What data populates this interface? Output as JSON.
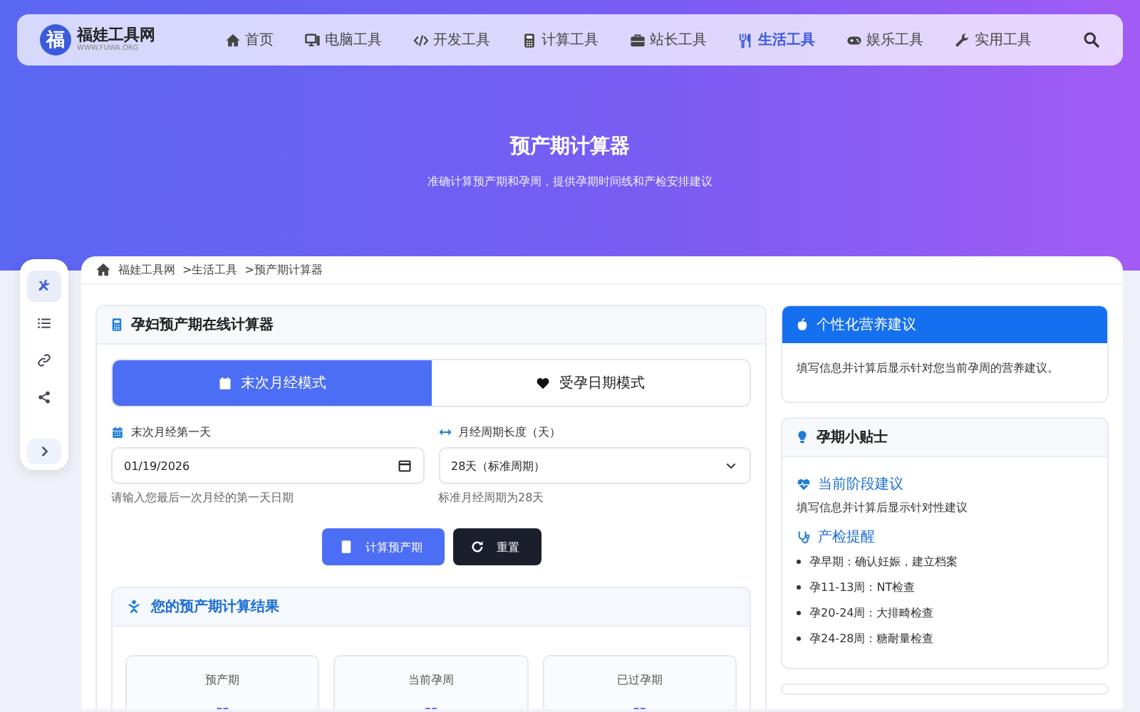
{
  "site": {
    "logo": "福",
    "name": "福娃工具网",
    "domain": "WWW.FUWA.ORG"
  },
  "nav": [
    {
      "label": "首页",
      "selected": false
    },
    {
      "label": "电脑工具",
      "selected": false
    },
    {
      "label": "开发工具",
      "selected": false
    },
    {
      "label": "计算工具",
      "selected": false
    },
    {
      "label": "站长工具",
      "selected": false
    },
    {
      "label": "生活工具",
      "selected": true
    },
    {
      "label": "娱乐工具",
      "selected": false
    },
    {
      "label": "实用工具",
      "selected": false
    }
  ],
  "hero": {
    "title": "预产期计算器",
    "subtitle": "准确计算预产期和孕周，提供孕期时间线和产检安排建议"
  },
  "sidebar": [
    {
      "selected": true
    },
    {
      "selected": false
    },
    {
      "selected": false
    },
    {
      "selected": false
    }
  ],
  "breadcrumb": [
    "福娃工具网",
    ">生活工具",
    ">预产期计算器"
  ],
  "calculator": {
    "title": "孕妇预产期在线计算器",
    "modes": [
      {
        "label": "末次月经模式",
        "selected": true
      },
      {
        "label": "受孕日期模式",
        "selected": false
      }
    ],
    "fields": [
      {
        "kind": "date",
        "label": "末次月经第一天",
        "value": "01/19/2026",
        "hint": "请输入您最后一次月经的第一天日期"
      },
      {
        "kind": "select",
        "label": "月经周期长度（天）",
        "value": "28天（标准周期）",
        "hint": "标准月经周期为28天"
      }
    ],
    "buttons": [
      {
        "kind": "primary",
        "label": "计算预产期"
      },
      {
        "kind": "dark",
        "label": "重置"
      }
    ],
    "result": {
      "title": "您的预产期计算结果",
      "cards": [
        {
          "label": "预产期",
          "value": "--"
        },
        {
          "label": "当前孕周",
          "value": "--"
        },
        {
          "label": "已过孕期",
          "value": "--"
        }
      ]
    }
  },
  "nutrition": {
    "title": "个性化营养建议",
    "text": "填写信息并计算后显示针对您当前孕周的营养建议。"
  },
  "tips": {
    "title": "孕期小贴士",
    "sections": [
      {
        "heading": "当前阶段建议",
        "text": "填写信息并计算后显示针对性建议"
      },
      {
        "heading": "产检提醒",
        "items": [
          "孕早期：确认妊娠，建立档案",
          "孕11-13周：NT检查",
          "孕20-24周：大排畸检查",
          "孕24-28周：糖耐量检查"
        ]
      }
    ]
  }
}
